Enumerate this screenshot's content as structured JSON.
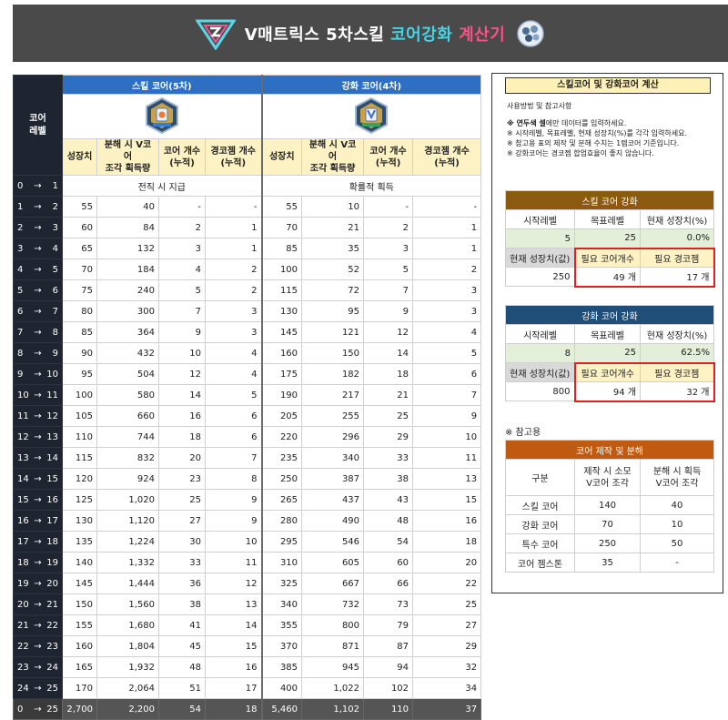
{
  "banner": {
    "title_part1": "V매트릭스 5차스킬 ",
    "title_part2": "코어강화 ",
    "title_part3": "계산기"
  },
  "main": {
    "level_header": "코어\n레벨",
    "skill_core_title": "스킬 코어(5차)",
    "enhance_core_title": "강화 코어(4차)",
    "columns": [
      "성장치",
      "분해 시 V코어\n조각 획득량",
      "코어 개수\n(누적)",
      "경코젬 개수\n(누적)"
    ],
    "first_row": {
      "from": "0",
      "arrow": "→",
      "to": "1",
      "skill_note": "전직 시 지급",
      "enhance_note": "확률적 획득"
    },
    "rows": [
      {
        "from": "1",
        "to": "2",
        "s": [
          "55",
          "40",
          "-",
          "-"
        ],
        "e": [
          "55",
          "10",
          "-",
          "-"
        ]
      },
      {
        "from": "2",
        "to": "3",
        "s": [
          "60",
          "84",
          "2",
          "1"
        ],
        "e": [
          "70",
          "21",
          "2",
          "1"
        ]
      },
      {
        "from": "3",
        "to": "4",
        "s": [
          "65",
          "132",
          "3",
          "1"
        ],
        "e": [
          "85",
          "35",
          "3",
          "1"
        ]
      },
      {
        "from": "4",
        "to": "5",
        "s": [
          "70",
          "184",
          "4",
          "2"
        ],
        "e": [
          "100",
          "52",
          "5",
          "2"
        ]
      },
      {
        "from": "5",
        "to": "6",
        "s": [
          "75",
          "240",
          "5",
          "2"
        ],
        "e": [
          "115",
          "72",
          "7",
          "3"
        ]
      },
      {
        "from": "6",
        "to": "7",
        "s": [
          "80",
          "300",
          "7",
          "3"
        ],
        "e": [
          "130",
          "95",
          "9",
          "3"
        ]
      },
      {
        "from": "7",
        "to": "8",
        "s": [
          "85",
          "364",
          "9",
          "3"
        ],
        "e": [
          "145",
          "121",
          "12",
          "4"
        ]
      },
      {
        "from": "8",
        "to": "9",
        "s": [
          "90",
          "432",
          "10",
          "4"
        ],
        "e": [
          "160",
          "150",
          "14",
          "5"
        ]
      },
      {
        "from": "9",
        "to": "10",
        "s": [
          "95",
          "504",
          "12",
          "4"
        ],
        "e": [
          "175",
          "182",
          "18",
          "6"
        ]
      },
      {
        "from": "10",
        "to": "11",
        "s": [
          "100",
          "580",
          "14",
          "5"
        ],
        "e": [
          "190",
          "217",
          "21",
          "7"
        ]
      },
      {
        "from": "11",
        "to": "12",
        "s": [
          "105",
          "660",
          "16",
          "6"
        ],
        "e": [
          "205",
          "255",
          "25",
          "9"
        ]
      },
      {
        "from": "12",
        "to": "13",
        "s": [
          "110",
          "744",
          "18",
          "6"
        ],
        "e": [
          "220",
          "296",
          "29",
          "10"
        ]
      },
      {
        "from": "13",
        "to": "14",
        "s": [
          "115",
          "832",
          "20",
          "7"
        ],
        "e": [
          "235",
          "340",
          "33",
          "11"
        ]
      },
      {
        "from": "14",
        "to": "15",
        "s": [
          "120",
          "924",
          "23",
          "8"
        ],
        "e": [
          "250",
          "387",
          "38",
          "13"
        ]
      },
      {
        "from": "15",
        "to": "16",
        "s": [
          "125",
          "1,020",
          "25",
          "9"
        ],
        "e": [
          "265",
          "437",
          "43",
          "15"
        ]
      },
      {
        "from": "16",
        "to": "17",
        "s": [
          "130",
          "1,120",
          "27",
          "9"
        ],
        "e": [
          "280",
          "490",
          "48",
          "16"
        ]
      },
      {
        "from": "17",
        "to": "18",
        "s": [
          "135",
          "1,224",
          "30",
          "10"
        ],
        "e": [
          "295",
          "546",
          "54",
          "18"
        ]
      },
      {
        "from": "18",
        "to": "19",
        "s": [
          "140",
          "1,332",
          "33",
          "11"
        ],
        "e": [
          "310",
          "605",
          "60",
          "20"
        ]
      },
      {
        "from": "19",
        "to": "20",
        "s": [
          "145",
          "1,444",
          "36",
          "12"
        ],
        "e": [
          "325",
          "667",
          "66",
          "22"
        ]
      },
      {
        "from": "20",
        "to": "21",
        "s": [
          "150",
          "1,560",
          "38",
          "13"
        ],
        "e": [
          "340",
          "732",
          "73",
          "25"
        ]
      },
      {
        "from": "21",
        "to": "22",
        "s": [
          "155",
          "1,680",
          "41",
          "14"
        ],
        "e": [
          "355",
          "800",
          "79",
          "27"
        ]
      },
      {
        "from": "22",
        "to": "23",
        "s": [
          "160",
          "1,804",
          "45",
          "15"
        ],
        "e": [
          "370",
          "871",
          "87",
          "29"
        ]
      },
      {
        "from": "23",
        "to": "24",
        "s": [
          "165",
          "1,932",
          "48",
          "16"
        ],
        "e": [
          "385",
          "945",
          "94",
          "32"
        ]
      },
      {
        "from": "24",
        "to": "25",
        "s": [
          "170",
          "2,064",
          "51",
          "17"
        ],
        "e": [
          "400",
          "1,022",
          "102",
          "34"
        ]
      }
    ],
    "total": {
      "from": "0",
      "to": "25",
      "s": [
        "2,700",
        "2,200",
        "54",
        "18"
      ],
      "e": [
        "5,460",
        "1,102",
        "110",
        "37"
      ]
    }
  },
  "panel": {
    "title": "스킬코어 및 강화코어 계산",
    "notes_heading": "사용방법 및 참고사항",
    "note1_bold": "※ 연두색 셀",
    "note1_rest": "에만 데이터를 입력하세요.",
    "note2": "※ 시작레벨, 목표레벨, 현재 성장치(%)를 각각 입력하세요.",
    "note3": "※ 참고용 표의 제작 및 분해 수치는 1렙코어 기준입니다.",
    "note4": "※ 강화코어는 경코젬 합업효율이 좋지 않습니다.",
    "skill_calc": {
      "title": "스킬 코어 강화",
      "h1": "시작레벨",
      "h2": "목표레벨",
      "h3": "현재 성장치(%)",
      "start": "5",
      "target": "25",
      "pct": "0.0%",
      "g_label": "현재 성장치(값)",
      "need_core": "필요 코어개수",
      "need_gem": "필요 경코젬",
      "g_value": "250",
      "core_value": "49 개",
      "gem_value": "17 개"
    },
    "enhance_calc": {
      "title": "강화 코어 강화",
      "h1": "시작레벨",
      "h2": "목표레벨",
      "h3": "현재 성장치(%)",
      "start": "8",
      "target": "25",
      "pct": "62.5%",
      "g_label": "현재 성장치(값)",
      "need_core": "필요 코어개수",
      "need_gem": "필요 경코젬",
      "g_value": "800",
      "core_value": "94 개",
      "gem_value": "32 개"
    },
    "ref_title": "※ 참고용",
    "ref": {
      "title": "코어 제작 및 분해",
      "h1": "구분",
      "h2": "제작 시 소모\nV코어 조각",
      "h3": "분해 시 획득\nV코어 조각",
      "rows": [
        {
          "k": "스킬 코어",
          "a": "140",
          "b": "40"
        },
        {
          "k": "강화 코어",
          "a": "70",
          "b": "10"
        },
        {
          "k": "특수 코어",
          "a": "250",
          "b": "50"
        },
        {
          "k": "코어 젬스톤",
          "a": "35",
          "b": "-"
        }
      ]
    }
  },
  "colors": {
    "banner": "#4a4a4a",
    "blue_header": "#2d6fc2",
    "yellow_header": "#fdf2c4",
    "input_green": "#e3efd9",
    "highlight_red": "#e02020"
  },
  "icons": [
    "v-matrix-logo-icon",
    "skill-core-icon",
    "enhance-core-icon",
    "core-gem-orb-icon"
  ]
}
